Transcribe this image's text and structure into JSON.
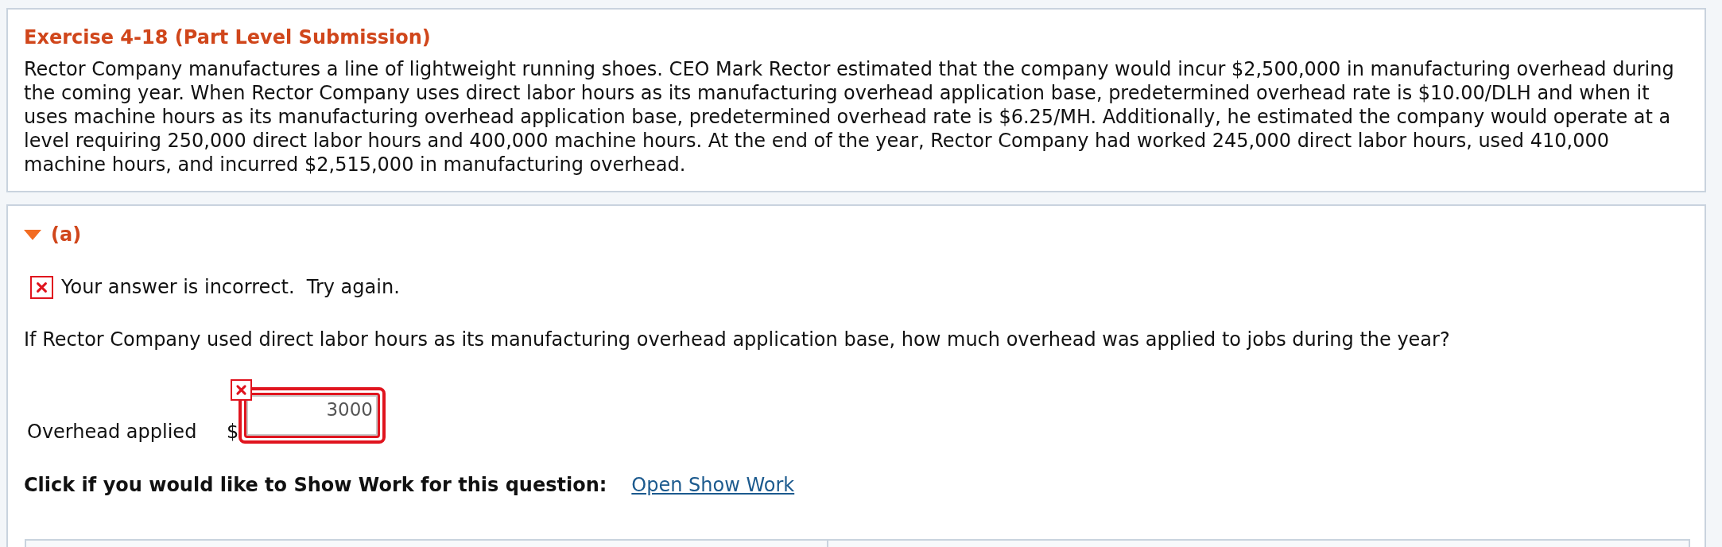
{
  "exercise": {
    "title": "Exercise 4-18 (Part Level Submission)",
    "text": "Rector Company manufactures a line of lightweight running shoes. CEO Mark Rector estimated that the company would incur $2,500,000 in manufacturing overhead during the coming year. When Rector Company uses direct labor hours as its manufacturing overhead application base, predetermined overhead rate is $10.00/DLH and when it uses machine hours as its manufacturing overhead application base, predetermined overhead rate is $6.25/MH. Additionally, he estimated the company would operate at a level requiring 250,000 direct labor hours and 400,000 machine hours. At the end of the year, Rector Company had worked 245,000 direct labor hours, used 410,000 machine hours, and incurred $2,515,000 in manufacturing overhead."
  },
  "part": {
    "label": "(a)",
    "expanded": true,
    "feedback": {
      "correct": false,
      "message": "Your answer is incorrect.  Try again."
    },
    "question": "If Rector Company used direct labor hours as its manufacturing overhead application base, how much overhead was applied to jobs during the year?",
    "answers": [
      {
        "label": "Overhead applied",
        "prefix": "$",
        "value": "3000",
        "correct": false
      }
    ],
    "show_work": {
      "prompt": "Click if you would like to Show Work for this question:",
      "link": "Open Show Work"
    }
  }
}
